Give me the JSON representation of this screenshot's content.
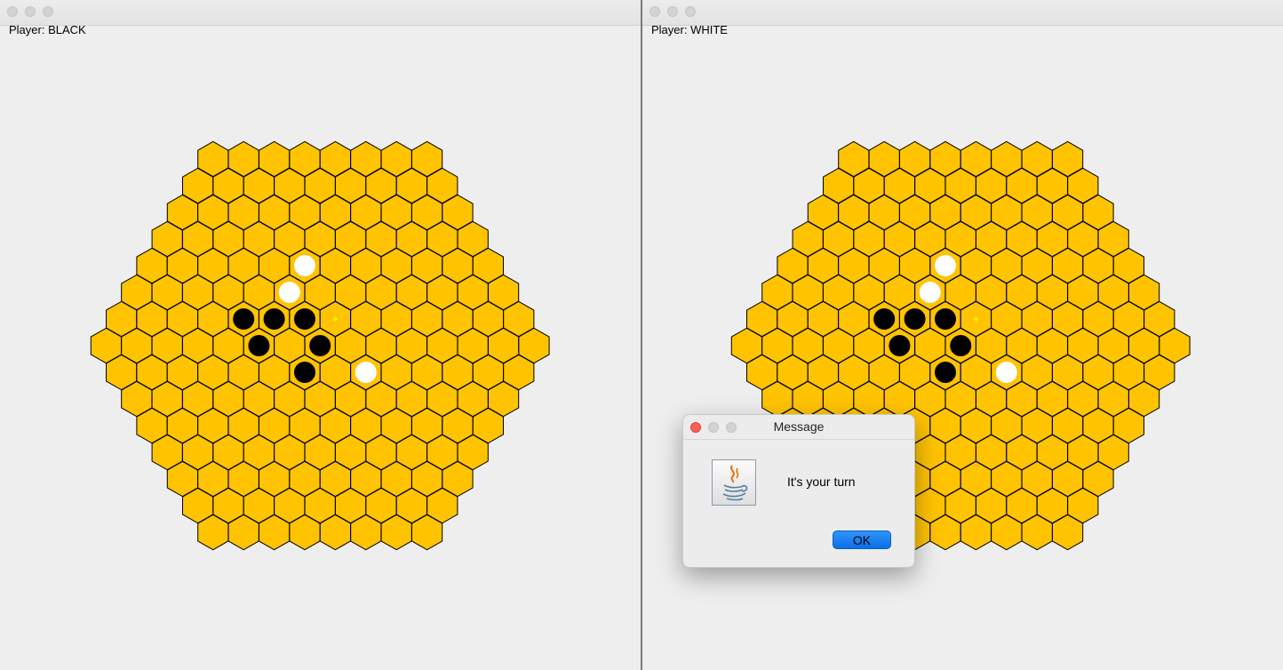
{
  "windows": [
    {
      "player_label": "Player: BLACK"
    },
    {
      "player_label": "Player: WHITE"
    }
  ],
  "board": {
    "radius": 7,
    "cell_color": "#ffc300",
    "stone_black": "#000000",
    "stone_white": "#ffffff",
    "hint_color": "#f5e800",
    "white_stones": [
      [
        1,
        -3
      ],
      [
        0,
        -2
      ],
      [
        1,
        1
      ]
    ],
    "black_stones": [
      [
        -2,
        -1
      ],
      [
        -1,
        -1
      ],
      [
        0,
        -1
      ],
      [
        -2,
        0
      ],
      [
        0,
        0
      ],
      [
        -1,
        1
      ]
    ],
    "hint_dots": [
      [
        1,
        -1
      ],
      [
        -1,
        1
      ],
      [
        1,
        1
      ]
    ]
  },
  "dialog": {
    "title": "Message",
    "message": "It's your turn",
    "ok_label": "OK",
    "icon": "java-icon"
  }
}
